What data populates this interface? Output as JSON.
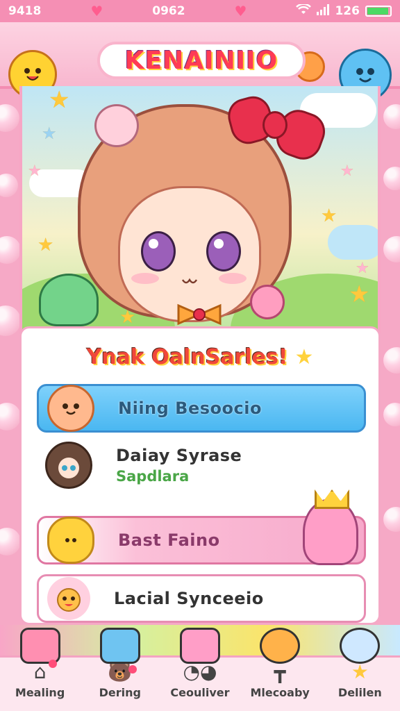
{
  "status_bar": {
    "time": "9418",
    "center": "0962",
    "right_text": "126",
    "battery_level": 0.95
  },
  "header": {
    "app_title": "KENAINIIO"
  },
  "panel": {
    "title": "Ynak OalnSarles!",
    "items": [
      {
        "label": "Niing Besoocio",
        "icon": "cat-icon",
        "style": "blue"
      },
      {
        "label": "Daiay Syrase",
        "sub": "Sapdlara",
        "icon": "girl-avatar-icon",
        "style": "plain"
      },
      {
        "label": "Bast Faino",
        "icon": "bean-icon",
        "style": "pink"
      },
      {
        "label": "Lacial Synceeio",
        "icon": "cat-icon",
        "style": "white"
      }
    ]
  },
  "bottom_nav": [
    {
      "label": "Mealing",
      "icon": "home-icon"
    },
    {
      "label": "Dering",
      "icon": "bear-icon"
    },
    {
      "label": "Ceouliver",
      "icon": "face-icon"
    },
    {
      "label": "Mlecoaby",
      "icon": "table-icon"
    },
    {
      "label": "Delilen",
      "icon": "star-icon"
    }
  ],
  "colors": {
    "accent": "#f58fb4",
    "title_red": "#ff3b55",
    "active_blue": "#4ab7f1",
    "pink_item": "#f7a9cb"
  }
}
